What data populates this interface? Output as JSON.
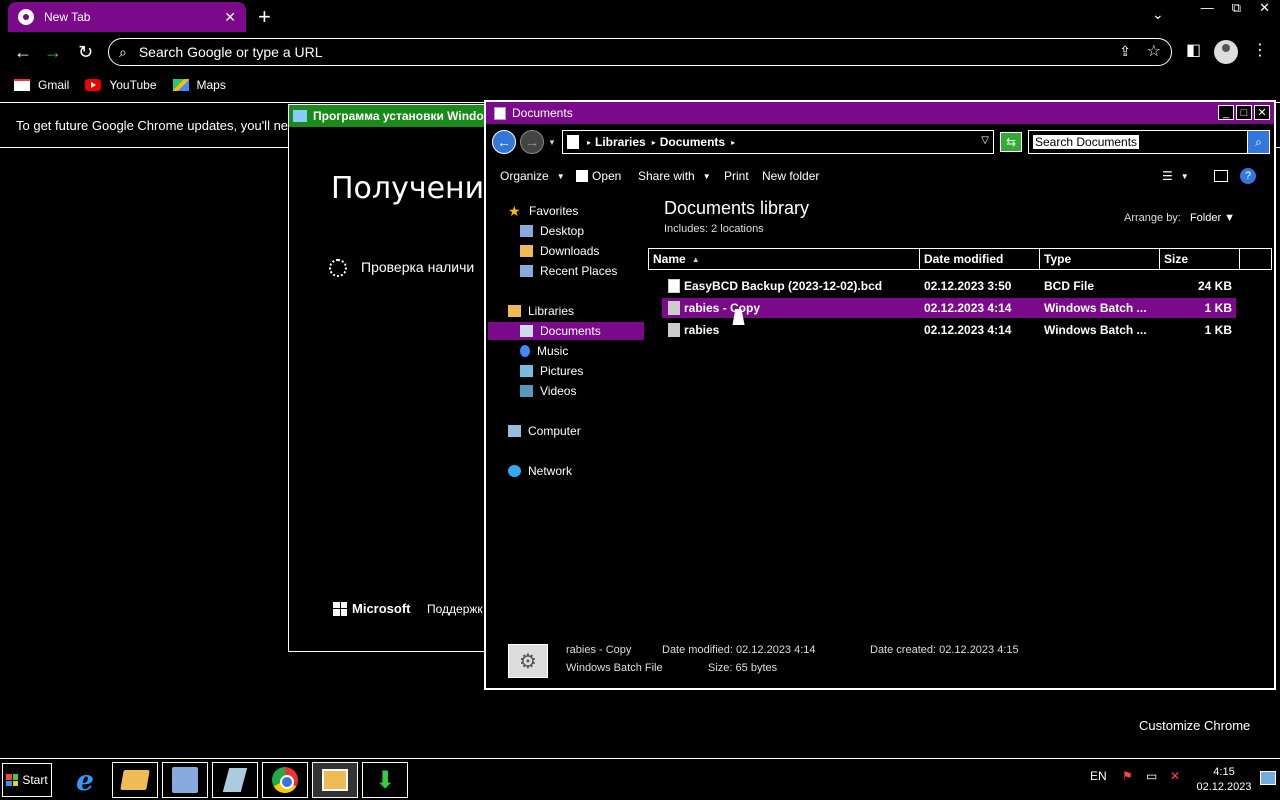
{
  "chrome": {
    "tab_title": "New Tab",
    "tab_close": "✕",
    "new_tab": "+",
    "tab_search": "⌄",
    "window_controls": {
      "minimize": "—",
      "restore": "⧉",
      "close": "✕"
    },
    "omnibox_placeholder": "Search Google or type a URL",
    "bookmarks": [
      {
        "label": "Gmail",
        "icon": "gmail-icon"
      },
      {
        "label": "YouTube",
        "icon": "youtube-icon"
      },
      {
        "label": "Maps",
        "icon": "maps-icon"
      }
    ],
    "infobar_text": "To get future Google Chrome updates, you'll ne",
    "customize_label": "Customize Chrome"
  },
  "setup_window": {
    "title": "Программа установки Windo",
    "heading": "Получение",
    "status": "Проверка наличи",
    "brand": "Microsoft",
    "support": "Поддержк"
  },
  "explorer": {
    "title": "Documents",
    "breadcrumb": [
      "Libraries",
      "Documents"
    ],
    "search_placeholder": "Search Documents",
    "commands": {
      "organize": "Organize",
      "open": "Open",
      "share_with": "Share with",
      "print": "Print",
      "new_folder": "New folder"
    },
    "nav": {
      "favorites": "Favorites",
      "desktop": "Desktop",
      "downloads": "Downloads",
      "recent_places": "Recent Places",
      "libraries": "Libraries",
      "documents": "Documents",
      "music": "Music",
      "pictures": "Pictures",
      "videos": "Videos",
      "computer": "Computer",
      "network": "Network"
    },
    "library_title": "Documents library",
    "includes_label": "Includes:",
    "includes_value": "2 locations",
    "arrange_label": "Arrange by:",
    "arrange_value": "Folder",
    "columns": {
      "name": "Name",
      "date": "Date modified",
      "type": "Type",
      "size": "Size"
    },
    "files": [
      {
        "name": "EasyBCD Backup (2023-12-02).bcd",
        "date": "02.12.2023 3:50",
        "type": "BCD File",
        "size": "24 KB"
      },
      {
        "name": "rabies - Copy",
        "date": "02.12.2023 4:14",
        "type": "Windows Batch ...",
        "size": "1 KB"
      },
      {
        "name": "rabies",
        "date": "02.12.2023 4:14",
        "type": "Windows Batch ...",
        "size": "1 KB"
      }
    ],
    "details": {
      "name": "rabies - Copy",
      "kind": "Windows Batch File",
      "modified_label": "Date modified:",
      "modified": "02.12.2023 4:14",
      "size_label": "Size:",
      "size": "65 bytes",
      "created_label": "Date created:",
      "created": "02.12.2023 4:15"
    }
  },
  "taskbar": {
    "start_label": "Start",
    "language": "EN",
    "time": "4:15",
    "date": "02.12.2023"
  },
  "colors": {
    "accent_purple": "#7a0a8a",
    "setup_title_green": "#1a8a1a",
    "background": "#000000",
    "text": "#ffffff"
  }
}
